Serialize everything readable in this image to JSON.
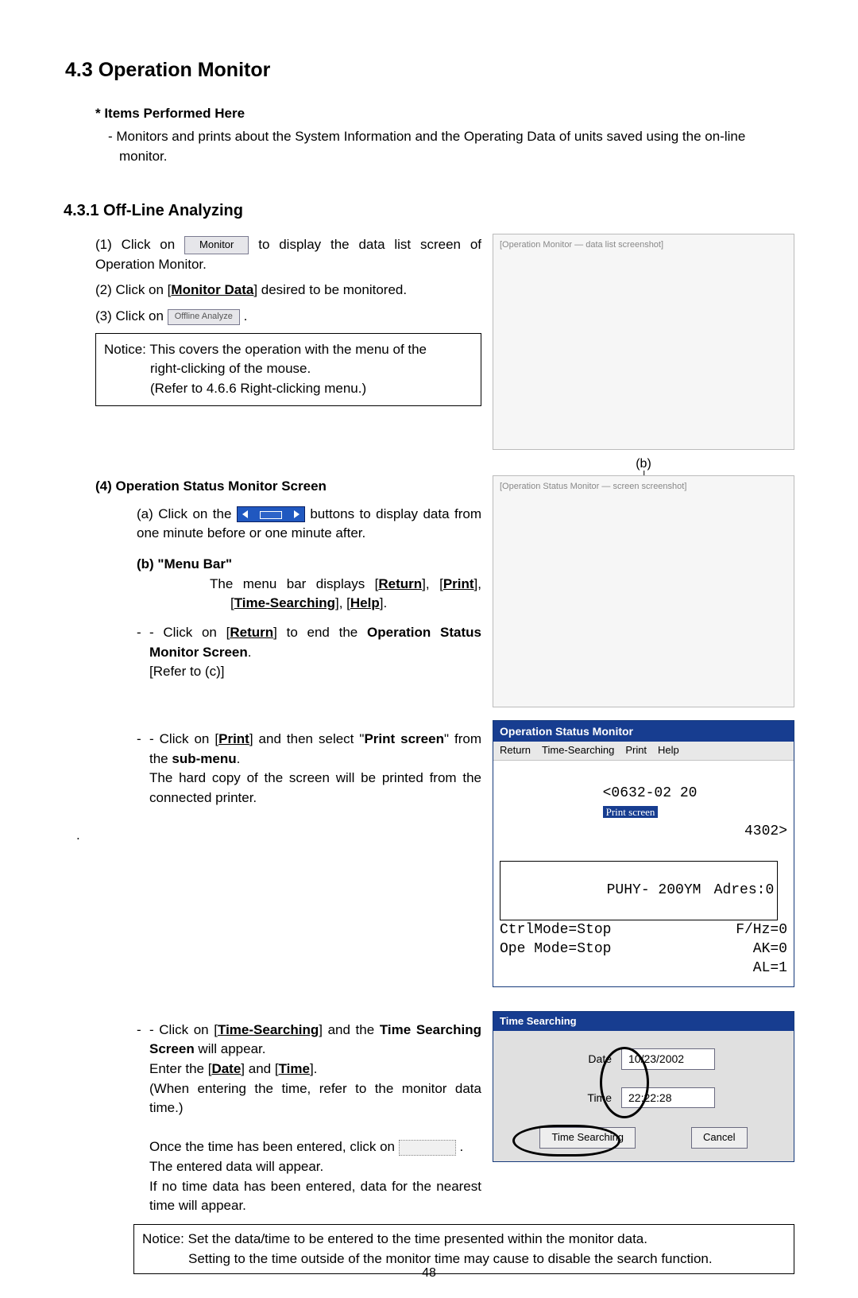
{
  "heading_main": "4.3 Operation Monitor",
  "items_head": "*  Items Performed Here",
  "items_body": "- Monitors and prints about the System Information and the Operating Data of units saved using the on-line monitor.",
  "heading_sub": "4.3.1 Off-Line Analyzing",
  "steps": {
    "one_pre": "(1)  Click on ",
    "one_btn": "Monitor",
    "one_post": " to display the data list screen of Operation Monitor.",
    "two_pre": "(2)  Click on [",
    "two_link": "Monitor Data",
    "two_post": "] desired to be monitored.",
    "three_pre": "(3)  Click on ",
    "three_btn": "Offline Analyze",
    "three_post": " ."
  },
  "notice1": {
    "l1": "Notice: This covers the operation with the menu of the",
    "l2": "right-clicking of the mouse.",
    "l3": "(Refer to 4.6.6 Right-clicking menu.)"
  },
  "marker_b": "(b)",
  "step4_head": "(4)    Operation Status Monitor Screen",
  "s4a_pre": "(a)  Click on the ",
  "s4a_post": " buttons to display data from one minute before or one minute after.",
  "s4b_head": "(b)  \"Menu Bar\"",
  "s4b_body_parts": {
    "pre": "The menu bar displays [",
    "r": "Return",
    "m": "], [",
    "p": "Print",
    "m2": "], [",
    "t": "Time-Searching",
    "m3": "], [",
    "h": "Help",
    "post": "]."
  },
  "s4_return": {
    "p1": "- Click on [",
    "link": "Return",
    "p2": "] to end the ",
    "bold": "Operation Status Monitor Screen",
    "p3": ".",
    "p4": "[Refer to (c)]"
  },
  "s4_print": {
    "p1": "- Click on [",
    "link": "Print",
    "p2": "] and then select \"",
    "bold": "Print screen",
    "p3": "\" from the ",
    "bold2": "sub-menu",
    "p4": ".",
    "p5": "The hard copy of the screen will be printed from the connected printer."
  },
  "s4_time": {
    "p1": "- Click on [",
    "link": "Time-Searching",
    "p2": "] and the ",
    "bold": "Time Searching Screen",
    "p3": " will appear.",
    "p4a": "Enter the [",
    "d": "Date",
    "p4b": "] and [",
    "t": "Time",
    "p4c": "].",
    "p5": "(When entering the time, refer to the monitor data time.)",
    "p6": "Once the time has been entered, click on ",
    "p6b": " .",
    "p7": "The entered data will appear.",
    "p8": "If no time data has been entered, data for the nearest time will appear."
  },
  "notice2": {
    "l1": "Notice: Set the data/time to be entered to the time presented within the monitor data.",
    "l2": "Setting to the time outside of the monitor time may cause to disable the search function."
  },
  "osm": {
    "title": "Operation Status Monitor",
    "menu": {
      "return": "Return",
      "time": "Time-Searching",
      "print": "Print",
      "help": "Help",
      "printscreen": "Print screen"
    },
    "row1_left": "<0632-02 20",
    "row1_right": "4302>",
    "row2_left": "PUHY- 200YM",
    "row2_right": "Adres:0",
    "row3_left": "CtrlMode=Stop",
    "row3_right": "F/Hz=0",
    "row4_left": "Ope Mode=Stop",
    "row4_right": "AK=0",
    "row5_right": "AL=1"
  },
  "ts": {
    "title": "Time Searching",
    "date_label": "Date",
    "date_value": "10/23/2002",
    "time_label": "Time",
    "time_value": "22:22:28",
    "btn_search": "Time Searching",
    "btn_cancel": "Cancel"
  },
  "fig1_hint": "[Operation Monitor — data list screenshot]",
  "fig2_hint": "[Operation Status Monitor — screen screenshot]",
  "page_num": "48",
  "dot": "."
}
